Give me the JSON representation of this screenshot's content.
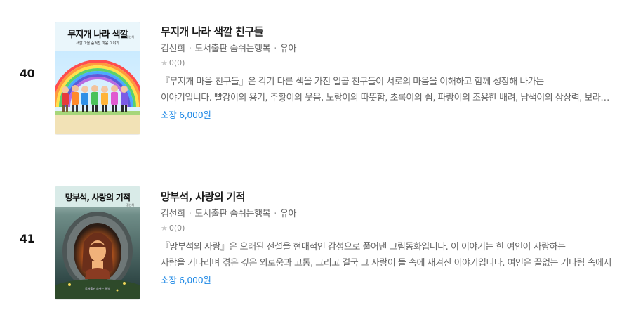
{
  "books": [
    {
      "rank": "40",
      "title": "무지개 나라 색깔 친구들",
      "author": "김선희",
      "publisher": "도서출판 숨쉬는행복",
      "category": "유아",
      "rating": "0(0)",
      "description_line1": "『무지개 마음 친구들』은 각기 다른 색을 가진 일곱 친구들이 서로의 마음을 이해하고 함께 성장해 나가는",
      "description_line2": "이야기입니다. 빨강이의 용기, 주황이의 웃음, 노랑이의 따뜻함, 초록이의 쉼, 파랑이의 조용한 배려, 남색이의 상상력, 보라의 지혜",
      "price": "소장 6,000원",
      "cover": {
        "title": "무지개 나라 색깔",
        "subtitle": "색깔 마을 숨겨진 마음 이야기",
        "author": "김선희"
      }
    },
    {
      "rank": "41",
      "title": "망부석, 사랑의 기적",
      "author": "김선희",
      "publisher": "도서출판 숨쉬는행복",
      "category": "유아",
      "rating": "0(0)",
      "description_line1": "『망부석의 사랑』은 오래된 전설을 현대적인 감성으로 풀어낸 그림동화입니다. 이 이야기는 한 여인이 사랑하는",
      "description_line2": "사람을 기다리며 겪은 깊은 외로움과 고통, 그리고 결국 그 사랑이 돌 속에 새겨진 이야기입니다. 여인은 끝없는 기다림 속에서",
      "price": "소장 6,000원",
      "cover": {
        "title": "망부석, 사랑의 기적",
        "author": "김선희",
        "bottom": "도서출판 숨쉬는 행복"
      }
    }
  ],
  "icons": {
    "rating": "star-icon"
  },
  "colors": {
    "price": "#1e88e5",
    "star": "#c8c8c8"
  }
}
